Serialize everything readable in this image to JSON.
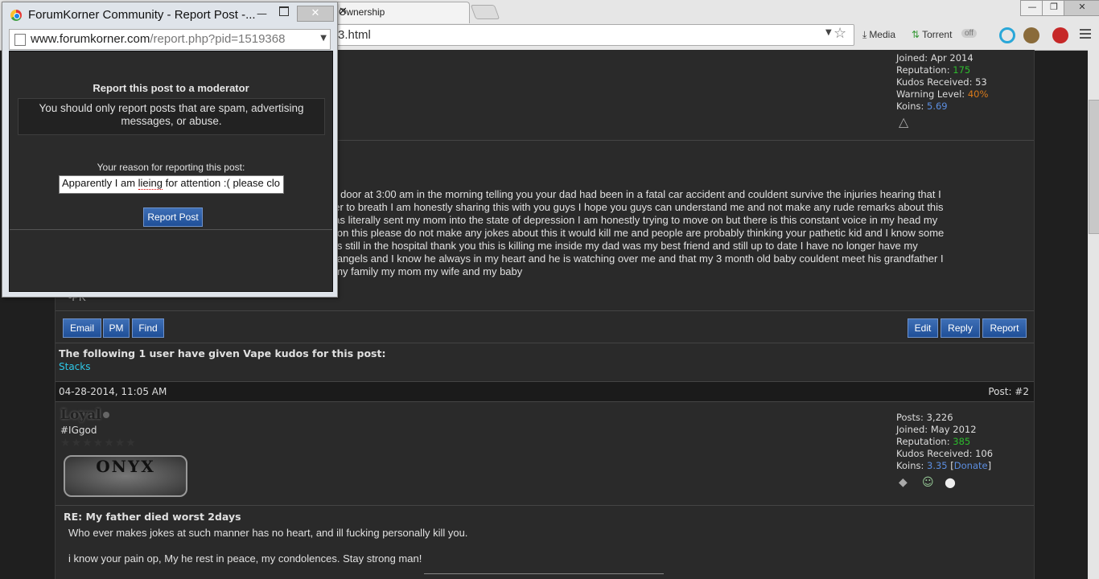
{
  "browser": {
    "tab_title": "Ownership",
    "url_tail": "3.html",
    "extensions": {
      "media": "Media",
      "torrent": "Torrent",
      "toggle": "off"
    }
  },
  "popup": {
    "window_title": "ForumKorner Community - Report Post -...",
    "url_host": "www.forumkorner.com",
    "url_path": "/report.php?pid=1519368",
    "heading": "Report this post to a moderator",
    "notice": "You should only report posts that are spam, advertising messages, or abuse.",
    "reason_label": "Your reason for reporting this post:",
    "reason_value_pre": "Apparently I am ",
    "reason_value_sq": "lieing",
    "reason_value_post": " for attention :( please clo",
    "submit_label": "Report Post"
  },
  "post1": {
    "stats": {
      "joined_label": "Joined:",
      "joined": "Apr 2014",
      "rep_label": "Reputation:",
      "rep": "175",
      "kudos_label": "Kudos Received:",
      "kudos": "53",
      "warn_label": "Warning Level:",
      "warn": "40%",
      "koins_label": "Koins:",
      "koins": "5.69"
    },
    "body_lines": [
      "ur door at 3:00 am in the morning telling you your dad had been in a fatal car accident and couldent survive the injuries hearing that I",
      "ger to breath I am honestly sharing this with you guys I hope you guys can understand me and not make any rude remarks about this",
      "has literally sent my mom into the state of depression I am honestly trying to move on but there is this constant voice in my head my",
      "g on this please do not make any jokes about this it would kill me and people are probably thinking your pathetic kid and I know some",
      "r is still in the hospital thank you this is killing me inside my dad was my best friend and still up to date I have no longer have my",
      "e angels and I know he always in my heart and he is watching over me and that my 3 month old baby couldent meet his grandfather I",
      "f my family my mom my wife and my baby"
    ],
    "signature": "-PK",
    "buttons": {
      "email": "Email",
      "pm": "PM",
      "find": "Find",
      "edit": "Edit",
      "reply": "Reply",
      "report": "Report"
    },
    "kudos_heading": "The following 1 user have given Vape kudos for this post:",
    "kudos_user": "Stacks"
  },
  "post2": {
    "date": "04-28-2014, 11:05 AM",
    "post_number": "Post: #2",
    "username": "Loyal",
    "usertitle": "#IGgod",
    "stars": "★★★★★★★",
    "group_badge": "ONYX",
    "stats": {
      "posts_label": "Posts:",
      "posts": "3,226",
      "joined_label": "Joined:",
      "joined": "May 2012",
      "rep_label": "Reputation:",
      "rep": "385",
      "kudos_label": "Kudos Received:",
      "kudos": "106",
      "koins_label": "Koins:",
      "koins": "3.35",
      "donate": "Donate"
    },
    "subject": "RE: My father died worst 2days",
    "body_lines": [
      "Who ever makes jokes at such manner has no heart, and ill fucking personally kill you.",
      "i know your pain op, My he rest in peace, my condolences. Stay strong man!"
    ]
  }
}
